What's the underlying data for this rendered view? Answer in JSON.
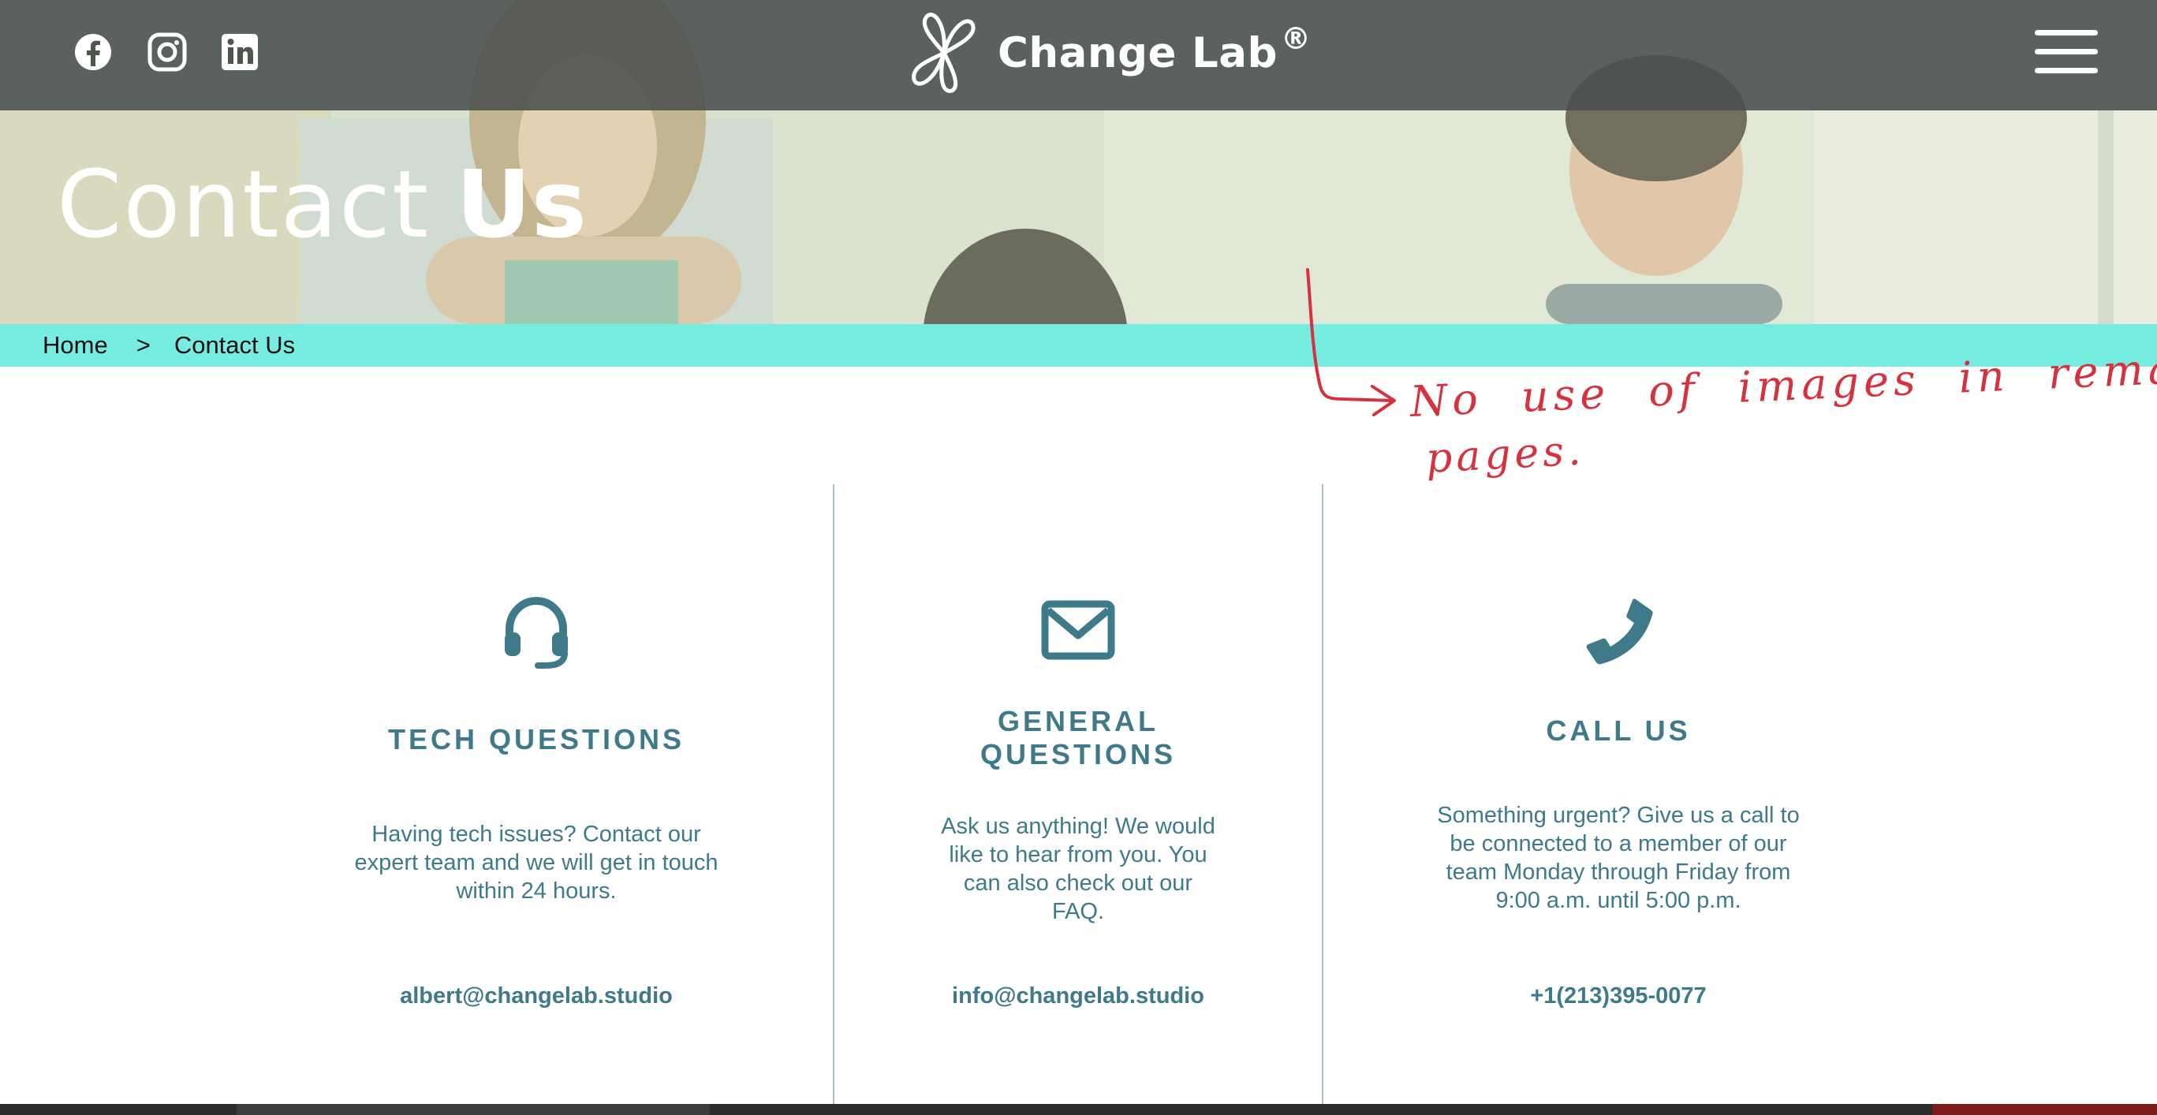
{
  "header": {
    "brand_name": "Change Lab",
    "brand_reg": "®",
    "social": [
      "facebook-icon",
      "instagram-icon",
      "linkedin-icon"
    ],
    "menu_icon": "hamburger-icon"
  },
  "hero": {
    "title_light": "Contact",
    "title_bold": "Us"
  },
  "breadcrumb": {
    "home": "Home",
    "separator": ">",
    "current": "Contact Us"
  },
  "annotation": {
    "line1": "No use of images in remaing",
    "line2": "pages.",
    "color": "#d6323e"
  },
  "columns": [
    {
      "icon": "headset-icon",
      "title": "TECH QUESTIONS",
      "description": "Having tech issues? Contact our expert team and we will get in touch within 24 hours.",
      "link": "albert@changelab.studio"
    },
    {
      "icon": "envelope-icon",
      "title": "GENERAL QUESTIONS",
      "description": "Ask us anything! We would like to hear from you. You can also check out our FAQ.",
      "link": "info@changelab.studio"
    },
    {
      "icon": "phone-icon",
      "title": "CALL US",
      "description": "Something urgent? Give us a call to be connected to a member of our team Monday through Friday from 9:00 a.m. until 5:00 p.m.",
      "link": "+1(213)395-0077"
    }
  ],
  "colors": {
    "accent_teal": "#3e7a8a",
    "breadcrumb_bg": "#77ece0",
    "topbar_bg": "#50564f"
  }
}
